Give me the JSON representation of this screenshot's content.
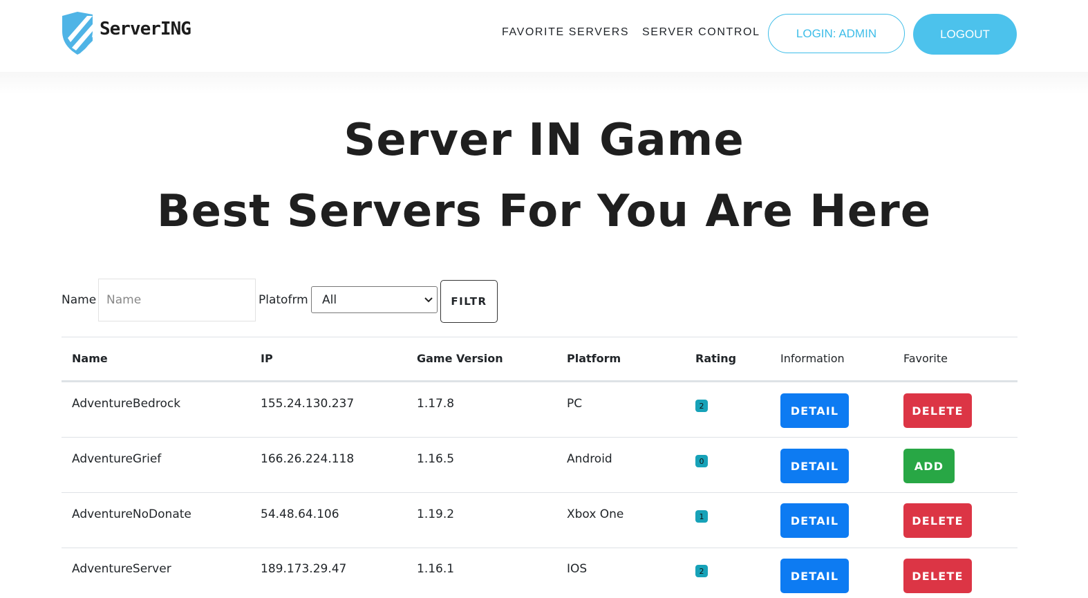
{
  "brand": {
    "name": "ServerING",
    "logo_icon": "shield-stripes-icon",
    "accent": "#4cc2ec"
  },
  "nav": {
    "favorite_servers": "FAVORITE SERVERS",
    "server_control": "SERVER CONTROL",
    "login": "LOGIN: ADMIN",
    "logout": "LOGOUT"
  },
  "hero": {
    "title": "Server IN Game",
    "subtitle": "Best Servers For You Are Here"
  },
  "filter": {
    "name_label": "Name",
    "name_placeholder": "Name",
    "name_value": "",
    "platform_label": "Platofrm",
    "platform_selected": "All",
    "filter_button": "FILTR"
  },
  "table": {
    "headers": {
      "name": "Name",
      "ip": "IP",
      "version": "Game Version",
      "platform": "Platform",
      "rating": "Rating",
      "information": "Information",
      "favorite": "Favorite"
    },
    "rows": [
      {
        "name": "AdventureBedrock",
        "ip": "155.24.130.237",
        "version": "1.17.8",
        "platform": "PC",
        "rating": "2",
        "info_button": "DETAIL",
        "favorite_button": "DELETE"
      },
      {
        "name": "AdventureGrief",
        "ip": "166.26.224.118",
        "version": "1.16.5",
        "platform": "Android",
        "rating": "0",
        "info_button": "DETAIL",
        "favorite_button": "ADD"
      },
      {
        "name": "AdventureNoDonate",
        "ip": "54.48.64.106",
        "version": "1.19.2",
        "platform": "Xbox One",
        "rating": "1",
        "info_button": "DETAIL",
        "favorite_button": "DELETE"
      },
      {
        "name": "AdventureServer",
        "ip": "189.173.29.47",
        "version": "1.16.1",
        "platform": "IOS",
        "rating": "2",
        "info_button": "DETAIL",
        "favorite_button": "DELETE"
      }
    ]
  },
  "colors": {
    "detail": "#0d7bf2",
    "delete": "#dc3545",
    "add": "#28a745",
    "rating_badge": "#17a2b8"
  }
}
